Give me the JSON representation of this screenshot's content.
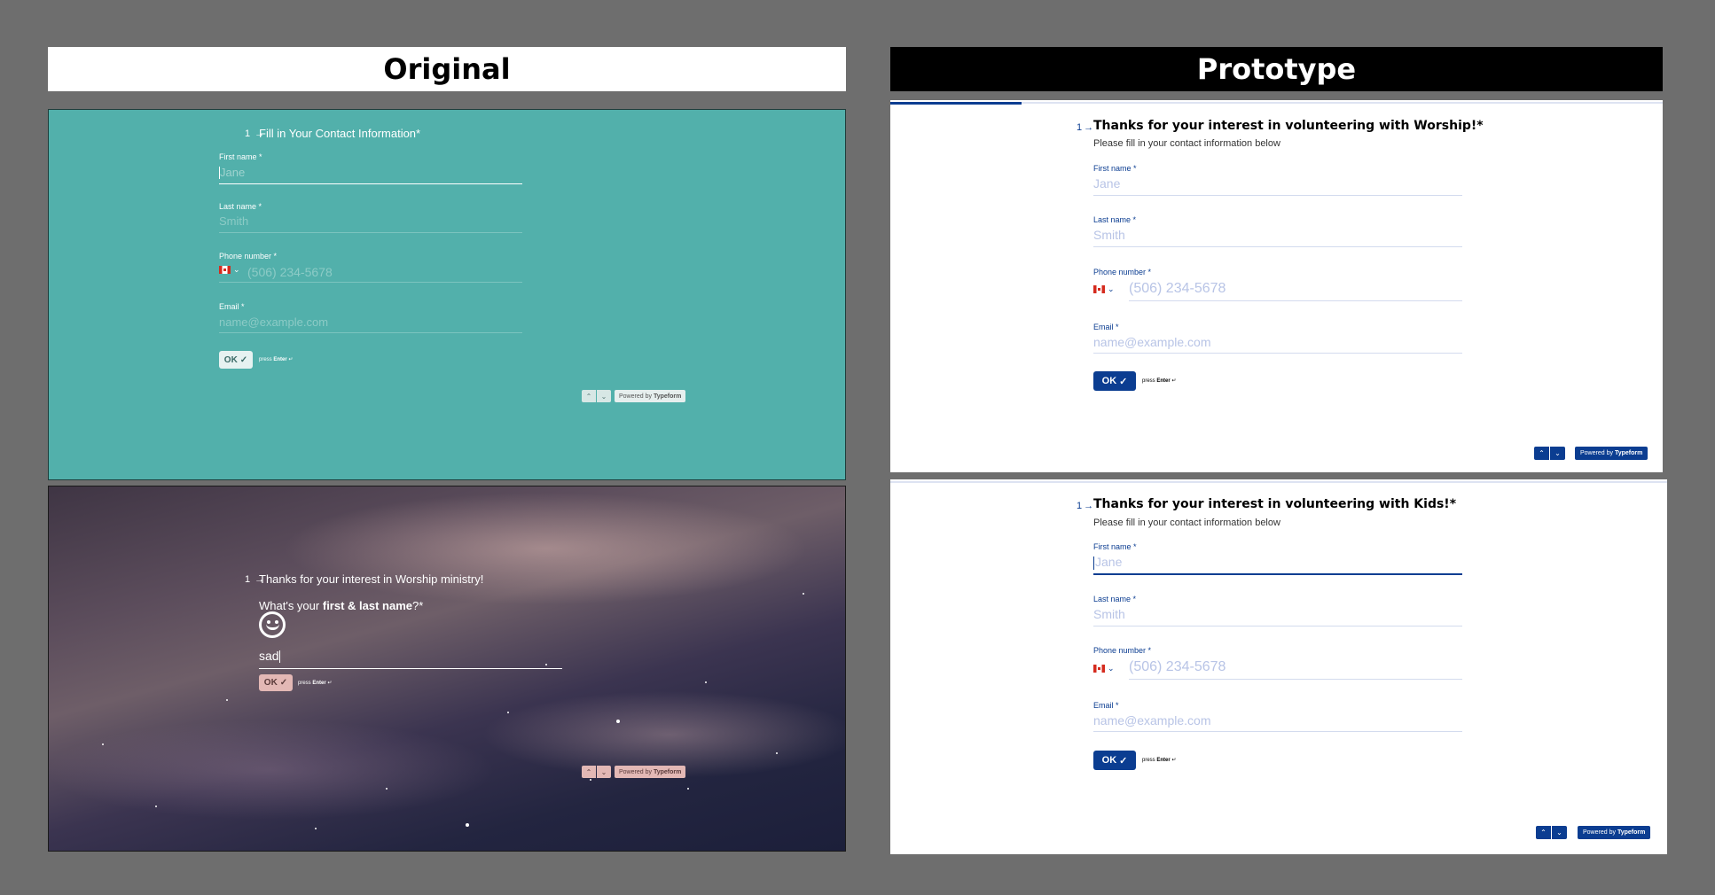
{
  "headers": {
    "original": "Original",
    "prototype": "Prototype"
  },
  "original_contact": {
    "question_number": "1",
    "question": "Fill in Your Contact Information*",
    "first_name_label": "First name *",
    "first_name_placeholder": "Jane",
    "last_name_label": "Last name *",
    "last_name_placeholder": "Smith",
    "phone_label": "Phone number *",
    "phone_placeholder": "(506) 234-5678",
    "email_label": "Email *",
    "email_placeholder": "name@example.com",
    "ok_label": "OK",
    "press_label": "press",
    "enter_label": "Enter",
    "powered_by": "Powered by",
    "brand": "Typeform"
  },
  "original_worship": {
    "question_number": "1",
    "intro": "Thanks for your interest in Worship ministry!",
    "question_prefix": "What's your",
    "question_bold": "first & last name",
    "question_suffix": "?*",
    "answer_value": "sad",
    "ok_label": "OK",
    "press_label": "press",
    "enter_label": "Enter",
    "powered_by": "Powered by",
    "brand": "Typeform"
  },
  "proto_worship": {
    "question_number": "1",
    "title": "Thanks for your interest in volunteering with Worship!*",
    "subtitle": "Please fill in your contact information below",
    "first_name_label": "First name *",
    "first_name_placeholder": "Jane",
    "last_name_label": "Last name *",
    "last_name_placeholder": "Smith",
    "phone_label": "Phone number *",
    "phone_placeholder": "(506) 234-5678",
    "email_label": "Email *",
    "email_placeholder": "name@example.com",
    "ok_label": "OK",
    "press_label": "press",
    "enter_label": "Enter",
    "powered_by": "Powered by",
    "brand": "Typeform",
    "progress": 0.17
  },
  "proto_kids": {
    "question_number": "1",
    "title": "Thanks for your interest in volunteering with Kids!*",
    "subtitle": "Please fill in your contact information below",
    "first_name_label": "First name *",
    "first_name_placeholder": "Jane",
    "last_name_label": "Last name *",
    "last_name_placeholder": "Smith",
    "phone_label": "Phone number *",
    "phone_placeholder": "(506) 234-5678",
    "email_label": "Email *",
    "email_placeholder": "name@example.com",
    "ok_label": "OK",
    "press_label": "press",
    "enter_label": "Enter",
    "powered_by": "Powered by",
    "brand": "Typeform"
  },
  "colors": {
    "teal_bg": "#52b0ab",
    "proto_blue": "#0b3d91",
    "proto_placeholder": "#b8c4e6",
    "pink_button": "#e3b8b5"
  },
  "icons": [
    "arrow-right-icon",
    "check-icon",
    "canada-flag-icon",
    "chevron-down-icon",
    "chevron-up-icon",
    "smiley-icon",
    "enter-icon"
  ]
}
